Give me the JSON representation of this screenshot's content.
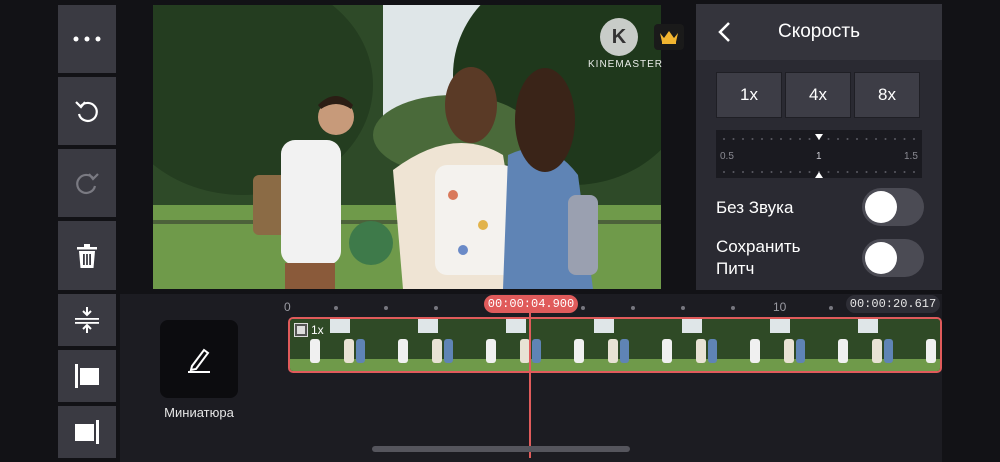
{
  "left_tools": [
    {
      "name": "more-icon"
    },
    {
      "name": "undo-icon"
    },
    {
      "name": "redo-icon"
    },
    {
      "name": "trash-icon"
    }
  ],
  "timeline_tools": [
    {
      "name": "expand-tracks-icon"
    },
    {
      "name": "clip-start-icon"
    },
    {
      "name": "clip-end-icon"
    }
  ],
  "preview": {
    "logo_letter": "K",
    "logo_text": "KINEMASTER",
    "premium_icon": "crown-icon"
  },
  "panel": {
    "title": "Скорость",
    "speed_buttons": [
      "1x",
      "4x",
      "8x"
    ],
    "ruler": {
      "min": "0.5",
      "mid": "1",
      "max": "1.5",
      "value": 1
    },
    "mute": {
      "label": "Без Звука",
      "on": false
    },
    "keep_pitch": {
      "label_line1": "Сохранить",
      "label_line2": "Питч",
      "on": false
    }
  },
  "timeline": {
    "thumbnail_label": "Миниатюра",
    "tick_start": "0",
    "tick_10": "10",
    "current_time": "00:00:04.900",
    "total_time": "00:00:20.617",
    "clip_speed": "1x"
  },
  "colors": {
    "accent": "#e05b5b",
    "panel": "#2a2a32",
    "tool": "#3a3a42"
  }
}
